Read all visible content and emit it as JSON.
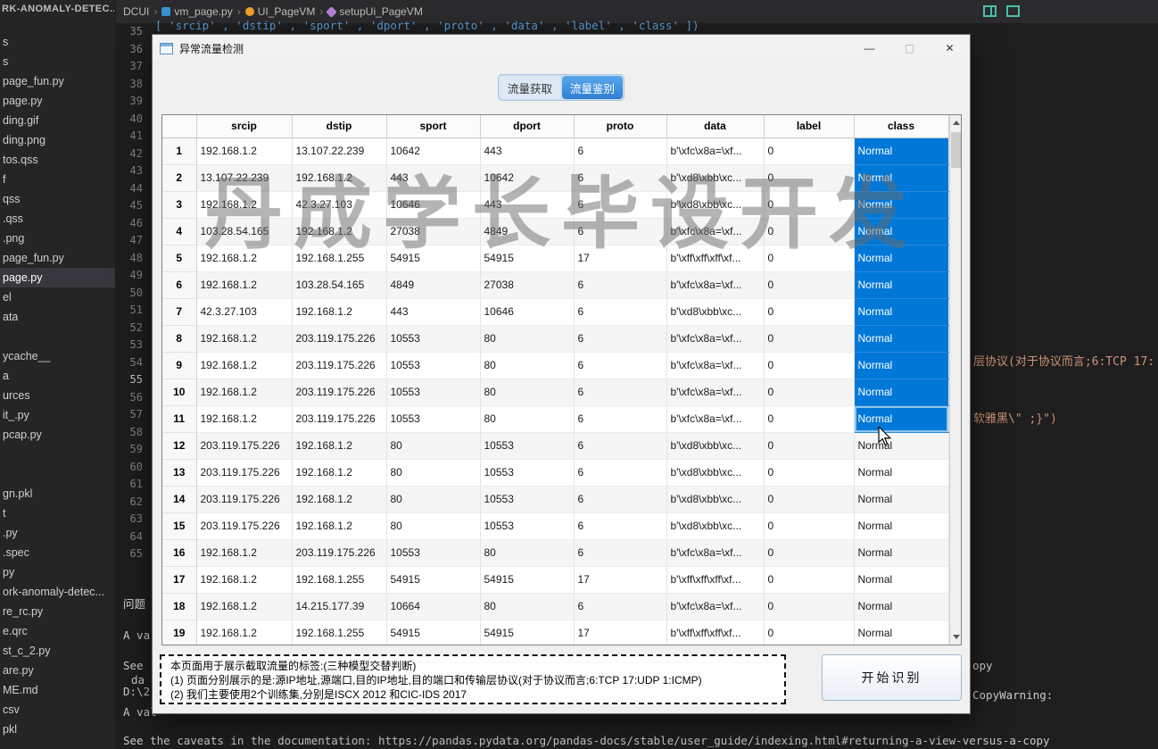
{
  "colors": {
    "selection_blue": "#0078d7",
    "tab_active_blue": "#3b8fdd",
    "code_string_orange": "#ce9178",
    "code_blue": "#569cd6",
    "editor_bg": "#1e1e1e",
    "sidebar_bg": "#252526"
  },
  "vscode": {
    "explorer_title": "RK-ANOMALY-DETEC...",
    "breadcrumb": [
      {
        "label": "DCUI",
        "icon": null
      },
      {
        "label": "vm_page.py",
        "icon": "file"
      },
      {
        "label": "UI_PageVM",
        "icon": "cls"
      },
      {
        "label": "setupUi_PageVM",
        "icon": "method"
      }
    ],
    "sidebar_items": [
      "s",
      "s",
      "page_fun.py",
      "page.py",
      "ding.gif",
      "ding.png",
      "tos.qss",
      "f",
      "qss",
      ".qss",
      ".png",
      "page_fun.py",
      "page.py",
      "el",
      "ata",
      "",
      "ycache__",
      "a",
      "urces",
      "it_.py",
      "pcap.py",
      "",
      "",
      "gn.pkl",
      "t",
      ".py",
      ".spec",
      "py",
      "ork-anomaly-detec...",
      "re_rc.py",
      "e.qrc",
      "st_c_2.py",
      "are.py",
      "ME.md",
      "csv",
      "pkl"
    ],
    "sidebar_active_index": 12,
    "line_numbers": {
      "start": 35,
      "end": 65,
      "active": 55
    },
    "code_top_line": "[ 'srcip' , 'dstip' , 'sport' , 'dport' , 'proto' , 'data' , 'label' , 'class' ])",
    "code_fragment_right_1": "层协议(对于协议而言;6:TCP 17:",
    "code_fragment_right_2": "软雅黑\\\" ;}\")",
    "panel": {
      "problems_tab": "问题",
      "frag_1": "A va",
      "frag_2": "See",
      "frag_3": "da",
      "frag_4": "D:\\2",
      "frag_5": "A val",
      "frag_right_1": "opy",
      "frag_right_2": "CopyWarning:",
      "caveats_line": "See the caveats in the documentation: https://pandas.pydata.org/pandas-docs/stable/user_guide/indexing.html#returning-a-view-versus-a-copy"
    }
  },
  "window": {
    "title": "异常流量检测",
    "controls": {
      "minimize": "—",
      "maximize": "▢",
      "close": "✕"
    },
    "tabs": [
      {
        "label": "流量获取",
        "active": false
      },
      {
        "label": "流量鉴别",
        "active": true
      }
    ],
    "watermark": "丹成学长毕设开发",
    "table": {
      "columns": [
        "srcip",
        "dstip",
        "sport",
        "dport",
        "proto",
        "data",
        "label",
        "class"
      ],
      "rows": [
        {
          "n": "1",
          "cells": [
            "192.168.1.2",
            "13.107.22.239",
            "10642",
            "443",
            "6",
            "b'\\xfc\\x8a=\\xf...",
            "0",
            "Normal"
          ],
          "class_selected": true,
          "focused": false
        },
        {
          "n": "2",
          "cells": [
            "13.107.22.239",
            "192.168.1.2",
            "443",
            "10642",
            "6",
            "b'\\xd8\\xbb\\xc...",
            "0",
            "Normal"
          ],
          "class_selected": true,
          "focused": false
        },
        {
          "n": "3",
          "cells": [
            "192.168.1.2",
            "42.3.27.103",
            "10646",
            "443",
            "6",
            "b'\\xd8\\xbb\\xc...",
            "0",
            "Normal"
          ],
          "class_selected": true,
          "focused": false
        },
        {
          "n": "4",
          "cells": [
            "103.28.54.165",
            "192.168.1.2",
            "27038",
            "4849",
            "6",
            "b'\\xfc\\x8a=\\xf...",
            "0",
            "Normal"
          ],
          "class_selected": true,
          "focused": false
        },
        {
          "n": "5",
          "cells": [
            "192.168.1.2",
            "192.168.1.255",
            "54915",
            "54915",
            "17",
            "b'\\xff\\xff\\xff\\xf...",
            "0",
            "Normal"
          ],
          "class_selected": true,
          "focused": false
        },
        {
          "n": "6",
          "cells": [
            "192.168.1.2",
            "103.28.54.165",
            "4849",
            "27038",
            "6",
            "b'\\xfc\\x8a=\\xf...",
            "0",
            "Normal"
          ],
          "class_selected": true,
          "focused": false
        },
        {
          "n": "7",
          "cells": [
            "42.3.27.103",
            "192.168.1.2",
            "443",
            "10646",
            "6",
            "b'\\xd8\\xbb\\xc...",
            "0",
            "Normal"
          ],
          "class_selected": true,
          "focused": false
        },
        {
          "n": "8",
          "cells": [
            "192.168.1.2",
            "203.119.175.226",
            "10553",
            "80",
            "6",
            "b'\\xfc\\x8a=\\xf...",
            "0",
            "Normal"
          ],
          "class_selected": true,
          "focused": false
        },
        {
          "n": "9",
          "cells": [
            "192.168.1.2",
            "203.119.175.226",
            "10553",
            "80",
            "6",
            "b'\\xfc\\x8a=\\xf...",
            "0",
            "Normal"
          ],
          "class_selected": true,
          "focused": false
        },
        {
          "n": "10",
          "cells": [
            "192.168.1.2",
            "203.119.175.226",
            "10553",
            "80",
            "6",
            "b'\\xfc\\x8a=\\xf...",
            "0",
            "Normal"
          ],
          "class_selected": true,
          "focused": false
        },
        {
          "n": "11",
          "cells": [
            "192.168.1.2",
            "203.119.175.226",
            "10553",
            "80",
            "6",
            "b'\\xfc\\x8a=\\xf...",
            "0",
            "Normal"
          ],
          "class_selected": true,
          "focused": true
        },
        {
          "n": "12",
          "cells": [
            "203.119.175.226",
            "192.168.1.2",
            "80",
            "10553",
            "6",
            "b'\\xd8\\xbb\\xc...",
            "0",
            "Normal"
          ],
          "class_selected": false,
          "focused": false
        },
        {
          "n": "13",
          "cells": [
            "203.119.175.226",
            "192.168.1.2",
            "80",
            "10553",
            "6",
            "b'\\xd8\\xbb\\xc...",
            "0",
            "Normal"
          ],
          "class_selected": false,
          "focused": false
        },
        {
          "n": "14",
          "cells": [
            "203.119.175.226",
            "192.168.1.2",
            "80",
            "10553",
            "6",
            "b'\\xd8\\xbb\\xc...",
            "0",
            "Normal"
          ],
          "class_selected": false,
          "focused": false
        },
        {
          "n": "15",
          "cells": [
            "203.119.175.226",
            "192.168.1.2",
            "80",
            "10553",
            "6",
            "b'\\xd8\\xbb\\xc...",
            "0",
            "Normal"
          ],
          "class_selected": false,
          "focused": false
        },
        {
          "n": "16",
          "cells": [
            "192.168.1.2",
            "203.119.175.226",
            "10553",
            "80",
            "6",
            "b'\\xfc\\x8a=\\xf...",
            "0",
            "Normal"
          ],
          "class_selected": false,
          "focused": false
        },
        {
          "n": "17",
          "cells": [
            "192.168.1.2",
            "192.168.1.255",
            "54915",
            "54915",
            "17",
            "b'\\xff\\xff\\xff\\xf...",
            "0",
            "Normal"
          ],
          "class_selected": false,
          "focused": false
        },
        {
          "n": "18",
          "cells": [
            "192.168.1.2",
            "14.215.177.39",
            "10664",
            "80",
            "6",
            "b'\\xfc\\x8a=\\xf...",
            "0",
            "Normal"
          ],
          "class_selected": false,
          "focused": false
        },
        {
          "n": "19",
          "cells": [
            "192.168.1.2",
            "192.168.1.255",
            "54915",
            "54915",
            "17",
            "b'\\xff\\xff\\xff\\xf...",
            "0",
            "Normal"
          ],
          "class_selected": false,
          "focused": false
        }
      ]
    },
    "info_box_lines": [
      "本页面用于展示截取流量的标签:(三种模型交替判断)",
      "(1) 页面分别展示的是:源IP地址,源端口,目的IP地址,目的端口和传输层协议(对于协议而言;6:TCP 17:UDP 1:ICMP)",
      "(2) 我们主要使用2个训练集,分别是ISCX 2012 和CIC-IDS 2017"
    ],
    "start_button": "开始识别"
  }
}
